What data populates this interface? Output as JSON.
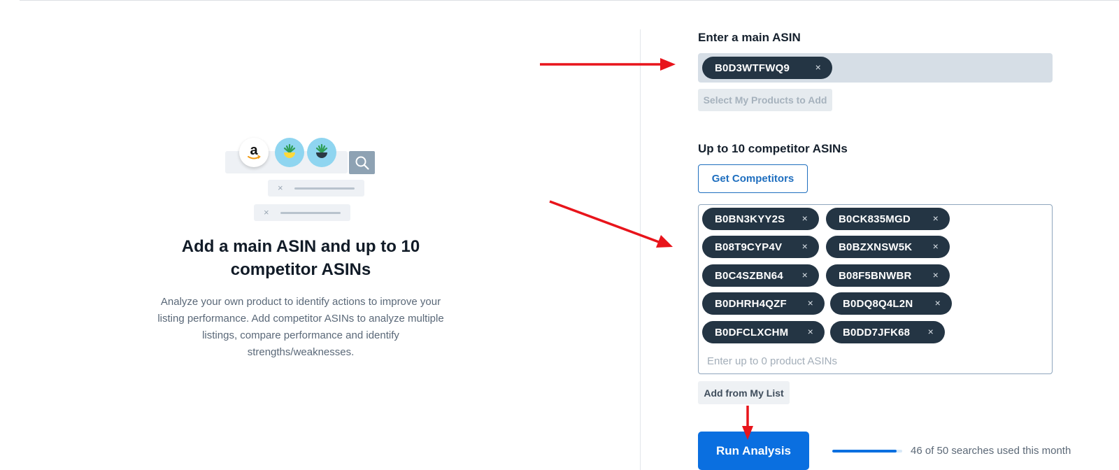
{
  "left": {
    "title": "Add a main ASIN and up to 10 competitor ASINs",
    "description": "Analyze your own product to identify actions to improve your listing performance. Add competitor ASINs to analyze multiple listings, compare performance and identify strengths/weaknesses.",
    "illustration": {
      "logo_letter": "a",
      "close_glyph": "×"
    }
  },
  "main_asin": {
    "label": "Enter a main ASIN",
    "chip": "B0D3WTFWQ9",
    "remove_glyph": "×",
    "select_products_button": "Select My Products to Add"
  },
  "competitors": {
    "label": "Up to 10 competitor ASINs",
    "get_button": "Get Competitors",
    "chips": [
      "B0BN3KYY2S",
      "B0CK835MGD",
      "B08T9CYP4V",
      "B0BZXNSW5K",
      "B0C4SZBN64",
      "B08F5BNWBR",
      "B0DHRH4QZF",
      "B0DQ8Q4L2N",
      "B0DFCLXCHM",
      "B0DD7JFK68"
    ],
    "remove_glyph": "×",
    "placeholder": "Enter up to 0 product ASINs",
    "add_from_list_button": "Add from My List"
  },
  "run": {
    "button": "Run Analysis",
    "usage_text": "46 of 50 searches used this month",
    "usage_fraction": 0.92
  },
  "colors": {
    "accent": "#0a6fe0",
    "chip_bg": "#243544",
    "annotation_arrow": "#e8141b"
  }
}
